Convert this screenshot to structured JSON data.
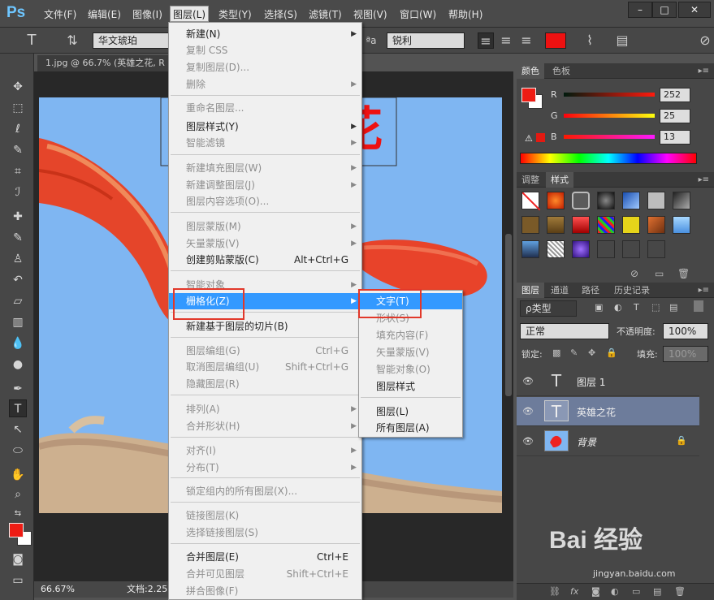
{
  "app": {
    "logo": "Ps",
    "menus": [
      "文件(F)",
      "编辑(E)",
      "图像(I)",
      "图层(L)",
      "类型(Y)",
      "选择(S)",
      "滤镜(T)",
      "视图(V)",
      "窗口(W)",
      "帮助(H)"
    ],
    "window_controls": [
      "–",
      "□",
      "✕"
    ]
  },
  "options": {
    "font_family": "华文琥珀",
    "antialias": "锐利",
    "aa_label": "ªa",
    "color": "#ee1111"
  },
  "document": {
    "tab_title": "1.jpg @ 66.7% (英雄之花, R",
    "zoom": "66.67%",
    "doc_info": "文档:2.25"
  },
  "layer_menu": {
    "items": [
      {
        "label": "新建(N)",
        "disabled": false,
        "submenu": true
      },
      {
        "label": "复制 CSS",
        "disabled": true
      },
      {
        "label": "复制图层(D)...",
        "disabled": true
      },
      {
        "label": "删除",
        "disabled": true,
        "submenu": true
      },
      {
        "label": "重命名图层...",
        "disabled": true
      },
      {
        "label": "图层样式(Y)",
        "disabled": false,
        "submenu": true
      },
      {
        "label": "智能滤镜",
        "disabled": true,
        "submenu": true
      },
      {
        "label": "新建填充图层(W)",
        "disabled": true,
        "submenu": true
      },
      {
        "label": "新建调整图层(J)",
        "disabled": true,
        "submenu": true
      },
      {
        "label": "图层内容选项(O)...",
        "disabled": true
      },
      {
        "label": "图层蒙版(M)",
        "disabled": true,
        "submenu": true
      },
      {
        "label": "矢量蒙版(V)",
        "disabled": true,
        "submenu": true
      },
      {
        "label": "创建剪贴蒙版(C)",
        "shortcut": "Alt+Ctrl+G",
        "disabled": false
      },
      {
        "label": "智能对象",
        "disabled": true,
        "submenu": true
      },
      {
        "label": "栅格化(Z)",
        "disabled": false,
        "submenu": true,
        "highlighted": true
      },
      {
        "label": "新建基于图层的切片(B)",
        "disabled": false
      },
      {
        "label": "图层编组(G)",
        "shortcut": "Ctrl+G",
        "disabled": true
      },
      {
        "label": "取消图层编组(U)",
        "shortcut": "Shift+Ctrl+G",
        "disabled": true
      },
      {
        "label": "隐藏图层(R)",
        "disabled": true
      },
      {
        "label": "排列(A)",
        "disabled": true,
        "submenu": true
      },
      {
        "label": "合并形状(H)",
        "disabled": true,
        "submenu": true
      },
      {
        "label": "对齐(I)",
        "disabled": true,
        "submenu": true
      },
      {
        "label": "分布(T)",
        "disabled": true,
        "submenu": true
      },
      {
        "label": "锁定组内的所有图层(X)...",
        "disabled": true
      },
      {
        "label": "链接图层(K)",
        "disabled": true
      },
      {
        "label": "选择链接图层(S)",
        "disabled": true
      },
      {
        "label": "合并图层(E)",
        "shortcut": "Ctrl+E",
        "disabled": false
      },
      {
        "label": "合并可见图层",
        "shortcut": "Shift+Ctrl+E",
        "disabled": true
      },
      {
        "label": "拼合图像(F)",
        "disabled": true
      }
    ]
  },
  "rasterize_menu": {
    "items": [
      {
        "label": "文字(T)",
        "disabled": false,
        "highlighted": true
      },
      {
        "label": "形状(S)",
        "disabled": true
      },
      {
        "label": "填充内容(F)",
        "disabled": true
      },
      {
        "label": "矢量蒙版(V)",
        "disabled": true
      },
      {
        "label": "智能对象(O)",
        "disabled": true
      },
      {
        "label": "图层样式",
        "disabled": false
      },
      {
        "label": "图层(L)",
        "disabled": false
      },
      {
        "label": "所有图层(A)",
        "disabled": false
      }
    ]
  },
  "color_panel": {
    "tabs": [
      "颜色",
      "色板"
    ],
    "r_label": "R",
    "r_value": "252",
    "g_label": "G",
    "g_value": "25",
    "b_label": "B",
    "b_value": "13"
  },
  "styles_panel": {
    "tabs": [
      "调整",
      "样式"
    ]
  },
  "layers_panel": {
    "tabs": [
      "图层",
      "通道",
      "路径",
      "历史记录"
    ],
    "filter_label": "ρ类型",
    "blend_mode": "正常",
    "opacity_label": "不透明度:",
    "opacity_value": "100%",
    "lock_label": "锁定:",
    "fill_label": "填充:",
    "fill_value": "100%",
    "layers": [
      {
        "name": "图层 1",
        "type": "text",
        "selected": false
      },
      {
        "name": "英雄之花",
        "type": "text",
        "selected": true
      },
      {
        "name": "背景",
        "type": "image",
        "selected": false,
        "locked": true
      }
    ]
  },
  "canvas_text": "花",
  "watermark": {
    "text": "Bai 经验",
    "sub": "jingyan.baidu.com"
  },
  "colors": {
    "foreground": "#ee1c14",
    "accent_blue": "#3399ff",
    "annot_red": "#e2382a"
  }
}
